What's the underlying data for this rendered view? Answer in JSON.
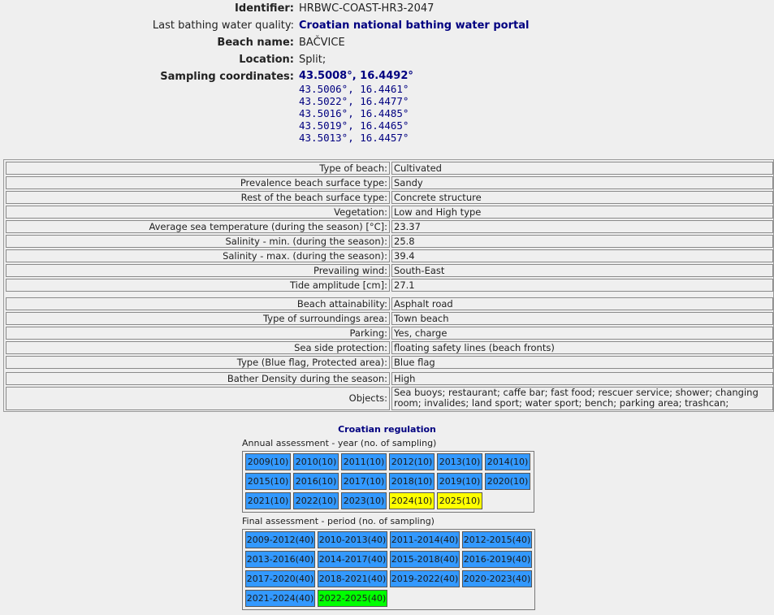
{
  "header": {
    "identifier_label": "Identifier:",
    "identifier_value": "HRBWC-COAST-HR3-2047",
    "quality_label": "Last bathing water quality:",
    "quality_link": "Croatian national bathing water portal",
    "beach_name_label": "Beach name:",
    "beach_name_value": "BAČVICE",
    "location_label": "Location:",
    "location_value": "Split;",
    "coords_label": "Sampling coordinates:",
    "coords": [
      "43.5008°, 16.4492°",
      "43.5006°, 16.4461°",
      "43.5022°, 16.4477°",
      "43.5016°, 16.4485°",
      "43.5019°, 16.4465°",
      "43.5013°, 16.4457°"
    ]
  },
  "attributes": [
    {
      "label": "Type of beach:",
      "value": "Cultivated"
    },
    {
      "label": "Prevalence beach surface type:",
      "value": "Sandy"
    },
    {
      "label": "Rest of the beach surface type:",
      "value": "Concrete structure"
    },
    {
      "label": "Vegetation:",
      "value": "Low and High type"
    },
    {
      "label": "Average sea temperature (during the season) [°C]:",
      "value": "23.37"
    },
    {
      "label": "Salinity - min. (during the season):",
      "value": "25.8"
    },
    {
      "label": "Salinity - max. (during the season):",
      "value": "39.4"
    },
    {
      "label": "Prevailing wind:",
      "value": "South-East"
    },
    {
      "label": "Tide amplitude [cm]:",
      "value": "27.1"
    },
    {
      "label": "Beach attainability:",
      "value": "Asphalt road"
    },
    {
      "label": "Type of surroundings area:",
      "value": "Town beach"
    },
    {
      "label": "Parking:",
      "value": "Yes, charge"
    },
    {
      "label": "Sea side protection:",
      "value": "floating safety lines (beach fronts)"
    },
    {
      "label": "Type (Blue flag, Protected area):",
      "value": "Blue flag"
    },
    {
      "label": "Bather Density during the season:",
      "value": "High"
    },
    {
      "label": "Objects:",
      "value": "Sea buoys; restaurant; caffe bar; fast food; rescuer service; shower; changing room; invalides; land sport; water sport; bench; parking area; trashcan;"
    }
  ],
  "regulation": {
    "title": "Croatian regulation",
    "annual_label": "Annual assessment - year (no. of sampling)",
    "annual": [
      {
        "label": "2009(10)",
        "status": "blue"
      },
      {
        "label": "2010(10)",
        "status": "blue"
      },
      {
        "label": "2011(10)",
        "status": "blue"
      },
      {
        "label": "2012(10)",
        "status": "blue"
      },
      {
        "label": "2013(10)",
        "status": "blue"
      },
      {
        "label": "2014(10)",
        "status": "blue"
      },
      {
        "label": "2015(10)",
        "status": "blue"
      },
      {
        "label": "2016(10)",
        "status": "blue"
      },
      {
        "label": "2017(10)",
        "status": "blue"
      },
      {
        "label": "2018(10)",
        "status": "blue"
      },
      {
        "label": "2019(10)",
        "status": "blue"
      },
      {
        "label": "2020(10)",
        "status": "blue"
      },
      {
        "label": "2021(10)",
        "status": "blue"
      },
      {
        "label": "2022(10)",
        "status": "blue"
      },
      {
        "label": "2023(10)",
        "status": "blue"
      },
      {
        "label": "2024(10)",
        "status": "yellow"
      },
      {
        "label": "2025(10)",
        "status": "yellow"
      }
    ],
    "final_label": "Final assessment - period (no. of sampling)",
    "final": [
      {
        "label": "2009-2012(40)",
        "status": "blue"
      },
      {
        "label": "2010-2013(40)",
        "status": "blue"
      },
      {
        "label": "2011-2014(40)",
        "status": "blue"
      },
      {
        "label": "2012-2015(40)",
        "status": "blue"
      },
      {
        "label": "2013-2016(40)",
        "status": "blue"
      },
      {
        "label": "2014-2017(40)",
        "status": "blue"
      },
      {
        "label": "2015-2018(40)",
        "status": "blue"
      },
      {
        "label": "2016-2019(40)",
        "status": "blue"
      },
      {
        "label": "2017-2020(40)",
        "status": "blue"
      },
      {
        "label": "2018-2021(40)",
        "status": "blue"
      },
      {
        "label": "2019-2022(40)",
        "status": "blue"
      },
      {
        "label": "2020-2023(40)",
        "status": "blue"
      },
      {
        "label": "2021-2024(40)",
        "status": "blue"
      },
      {
        "label": "2022-2025(40)",
        "status": "green"
      }
    ]
  },
  "colors": {
    "blue": "#3399ff",
    "yellow": "#ffff00",
    "green": "#00ff00",
    "link": "#000080"
  }
}
